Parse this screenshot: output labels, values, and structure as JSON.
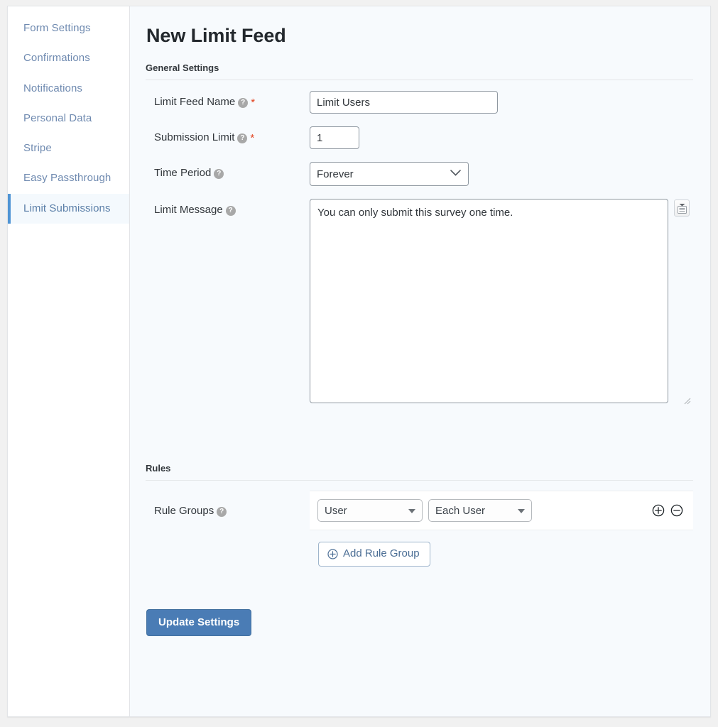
{
  "sidebar": {
    "items": [
      {
        "label": "Form Settings",
        "active": false
      },
      {
        "label": "Confirmations",
        "active": false
      },
      {
        "label": "Notifications",
        "active": false
      },
      {
        "label": "Personal Data",
        "active": false
      },
      {
        "label": "Stripe",
        "active": false
      },
      {
        "label": "Easy Passthrough",
        "active": false
      },
      {
        "label": "Limit Submissions",
        "active": true
      }
    ]
  },
  "main": {
    "title": "New Limit Feed",
    "sections": {
      "general": {
        "heading": "General Settings"
      },
      "rules": {
        "heading": "Rules"
      }
    },
    "fields": {
      "feed_name": {
        "label": "Limit Feed Name",
        "help_icon": "question-mark-icon",
        "required_marker": "*",
        "value": "Limit Users",
        "placeholder": ""
      },
      "submission_limit": {
        "label": "Submission Limit",
        "help_icon": "question-mark-icon",
        "required_marker": "*",
        "value": "1",
        "placeholder": ""
      },
      "time_period": {
        "label": "Time Period",
        "help_icon": "question-mark-icon",
        "value": "Forever",
        "options": [
          "Forever"
        ],
        "chevron_icon": "chevron-down-icon"
      },
      "limit_message": {
        "label": "Limit Message",
        "help_icon": "question-mark-icon",
        "value": "You can only submit this survey one time.",
        "placeholder": "",
        "merge_tag_icon": "merge-tags-icon",
        "resize_handle_icon": "resize-grip-icon"
      },
      "rule_groups": {
        "label": "Rule Groups",
        "help_icon": "question-mark-icon",
        "row": {
          "select_type": {
            "value": "User",
            "options": [
              "User"
            ],
            "arrow_icon": "triangle-down-icon"
          },
          "select_scope": {
            "value": "Each User",
            "options": [
              "Each User"
            ],
            "arrow_icon": "triangle-down-icon"
          },
          "add_icon": "circle-plus-icon",
          "remove_icon": "circle-minus-icon"
        }
      }
    },
    "buttons": {
      "add_rule_group": {
        "label": "Add Rule Group",
        "icon": "circle-plus-icon"
      },
      "update_settings": {
        "label": "Update Settings"
      }
    }
  },
  "colors": {
    "accent_blue": "#4a7cb5",
    "active_nav_border": "#4f94d4",
    "nav_link": "#6f8ab0",
    "required_red": "#e2401c",
    "panel_bg": "#f7fafd",
    "sidebar_bg": "#ffffff"
  }
}
